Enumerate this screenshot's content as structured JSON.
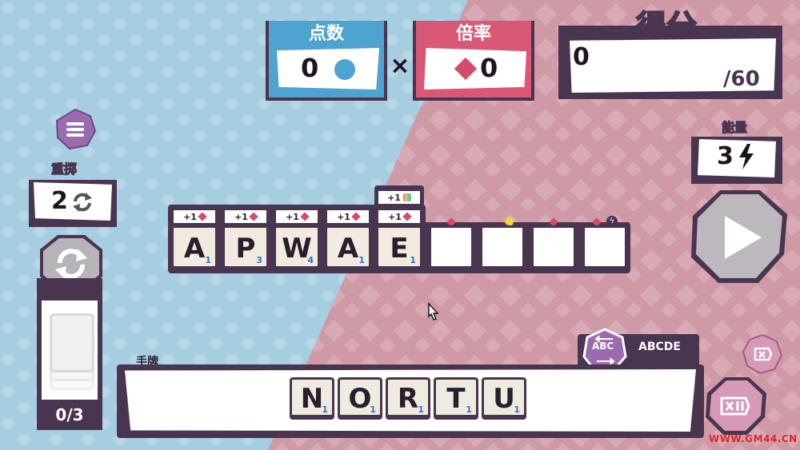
{
  "colors": {
    "blue_bg": "#a7cde0",
    "pink_bg": "#cf9aa6",
    "dark": "#4a3550",
    "points_blue": "#4fa3d1",
    "mult_pink": "#d95876",
    "diamond": "#d64a6a",
    "tile": "#f1ecdf",
    "tile_value": "#2f6fd0"
  },
  "points": {
    "label": "点数",
    "value": "0"
  },
  "multiplier": {
    "label": "倍率",
    "value": "0",
    "times_sign": "×"
  },
  "score": {
    "label": "得分",
    "value": "0",
    "target": "/60"
  },
  "energy": {
    "label": "能量",
    "value": "3"
  },
  "reroll": {
    "label": "重掷",
    "value": "2"
  },
  "deck": {
    "count": "0/3"
  },
  "board": {
    "tiles": [
      {
        "letter": "A",
        "value": "1",
        "bonus": "+1"
      },
      {
        "letter": "P",
        "value": "3",
        "bonus": "+1"
      },
      {
        "letter": "W",
        "value": "4",
        "bonus": "+1"
      },
      {
        "letter": "A",
        "value": "1",
        "bonus": "+1"
      },
      {
        "letter": "E",
        "value": "1",
        "bonus": "+1",
        "extra_bonus": "+1"
      }
    ],
    "empty_slots": 4
  },
  "hand": {
    "label": "手牌",
    "sort_icon_label": "ABC",
    "sort_label": "ABCDE",
    "tiles": [
      {
        "letter": "N",
        "value": "1"
      },
      {
        "letter": "O",
        "value": "1"
      },
      {
        "letter": "R",
        "value": "1"
      },
      {
        "letter": "T",
        "value": "1"
      },
      {
        "letter": "U",
        "value": "1"
      }
    ]
  },
  "watermark": "WWW.GM44.CN",
  "icons": [
    "menu-icon",
    "refresh-icon",
    "lightning-icon",
    "play-icon",
    "delete-icon",
    "delete-all-icon",
    "sort-icon",
    "cursor-icon"
  ]
}
